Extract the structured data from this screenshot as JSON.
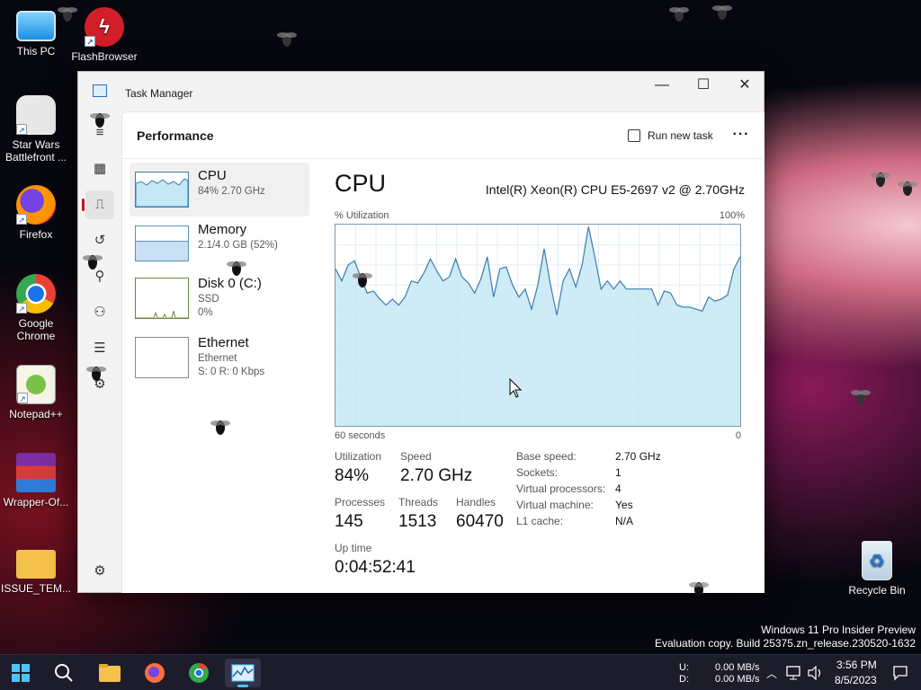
{
  "desktop": {
    "icons": [
      {
        "label": "This PC"
      },
      {
        "label": "FlashBrowser"
      },
      {
        "label": "Star Wars Battlefront ..."
      },
      {
        "label": "Firefox"
      },
      {
        "label": "Google Chrome"
      },
      {
        "label": "Notepad++"
      },
      {
        "label": "Wrapper-Of..."
      },
      {
        "label": "ISSUE_TEM..."
      },
      {
        "label": "Recycle Bin"
      }
    ],
    "watermark": {
      "line1": "Windows 11 Pro Insider Preview",
      "line2": "Evaluation copy. Build 25375.zn_release.230520-1632"
    }
  },
  "window": {
    "title": "Task Manager",
    "minimize": "—",
    "maximize": "☐",
    "close": "✕"
  },
  "header": {
    "page_title": "Performance",
    "run_new_task": "Run new task",
    "more": "···"
  },
  "nav": {
    "icons": [
      "menu-icon",
      "processes-icon",
      "performance-icon",
      "app-history-icon",
      "startup-icon",
      "users-icon",
      "details-icon",
      "services-icon",
      "settings-icon"
    ]
  },
  "devices": [
    {
      "name": "CPU",
      "sub1": "84%  2.70 GHz",
      "sub2": ""
    },
    {
      "name": "Memory",
      "sub1": "2.1/4.0 GB (52%)",
      "sub2": ""
    },
    {
      "name": "Disk 0 (C:)",
      "sub1": "SSD",
      "sub2": "0%"
    },
    {
      "name": "Ethernet",
      "sub1": "Ethernet",
      "sub2": "S: 0  R: 0 Kbps"
    }
  ],
  "cpu": {
    "title": "CPU",
    "model": "Intel(R) Xeon(R) CPU E5-2697 v2 @ 2.70GHz",
    "util_label": "% Utilization",
    "util_max": "100%",
    "graph_left": "60 seconds",
    "graph_right": "0",
    "utilization_series": [
      78,
      72,
      80,
      82,
      74,
      66,
      67,
      63,
      60,
      63,
      60,
      64,
      72,
      71,
      76,
      83,
      77,
      72,
      74,
      83,
      74,
      71,
      66,
      73,
      84,
      64,
      78,
      79,
      70,
      64,
      68,
      58,
      70,
      88,
      70,
      55,
      72,
      78,
      69,
      80,
      99,
      84,
      68,
      72,
      68,
      72,
      68,
      68,
      68,
      68,
      68,
      60,
      67,
      66,
      60,
      59,
      59,
      58,
      57,
      64,
      62,
      63,
      65,
      78,
      84
    ],
    "stats": {
      "utilization_label": "Utilization",
      "utilization": "84%",
      "speed_label": "Speed",
      "speed": "2.70 GHz",
      "processes_label": "Processes",
      "processes": "145",
      "threads_label": "Threads",
      "threads": "1513",
      "handles_label": "Handles",
      "handles": "60470",
      "uptime_label": "Up time",
      "uptime": "0:04:52:41"
    },
    "specs": [
      {
        "label": "Base speed:",
        "value": "2.70 GHz"
      },
      {
        "label": "Sockets:",
        "value": "1"
      },
      {
        "label": "Virtual processors:",
        "value": "4"
      },
      {
        "label": "Virtual machine:",
        "value": "Yes"
      },
      {
        "label": "L1 cache:",
        "value": "N/A"
      }
    ]
  },
  "taskbar": {
    "apps": [
      "start-icon",
      "search-icon",
      "file-explorer-icon",
      "firefox-icon",
      "chrome-icon",
      "task-manager-icon"
    ],
    "net_u_label": "U:",
    "net_d_label": "D:",
    "net_u": "0.00 MB/s",
    "net_d": "0.00 MB/s",
    "time": "3:56 PM",
    "date": "8/5/2023"
  },
  "colors": {
    "graph_fill": "#c6e8f5",
    "graph_line": "#3a7cb1",
    "accent": "#b5162d"
  }
}
